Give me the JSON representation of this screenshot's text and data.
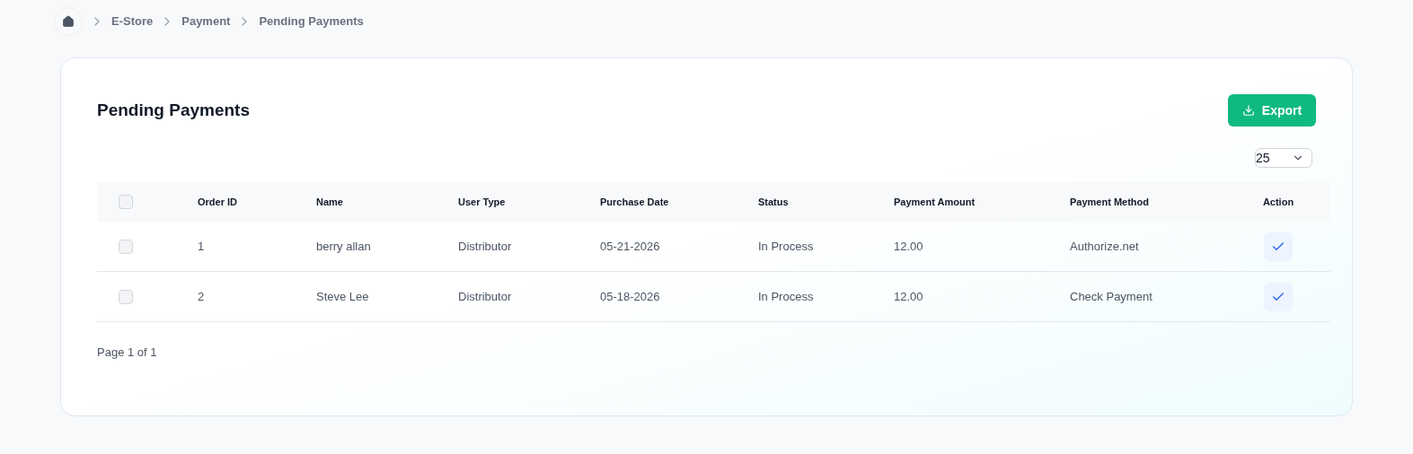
{
  "breadcrumb": [
    {
      "label": "E-Store"
    },
    {
      "label": "Payment"
    },
    {
      "label": "Pending Payments"
    }
  ],
  "title": "Pending Payments",
  "export_button": "Export",
  "page_size": "25",
  "table": {
    "select_all_checked": false,
    "columns": [
      "Order ID",
      "Name",
      "User Type",
      "Purchase Date",
      "Status",
      "Payment Amount",
      "Payment Method",
      "Action"
    ],
    "rows": [
      {
        "checked": false,
        "cells": [
          "1",
          "berry allan",
          "Distributor",
          "05-21-2026",
          "In Process",
          "12.00",
          "Authorize.net"
        ]
      },
      {
        "checked": false,
        "cells": [
          "2",
          "Steve Lee",
          "Distributor",
          "05-18-2026",
          "In Process",
          "12.00",
          "Check Payment"
        ]
      }
    ]
  },
  "pagination": "Page 1 of 1"
}
